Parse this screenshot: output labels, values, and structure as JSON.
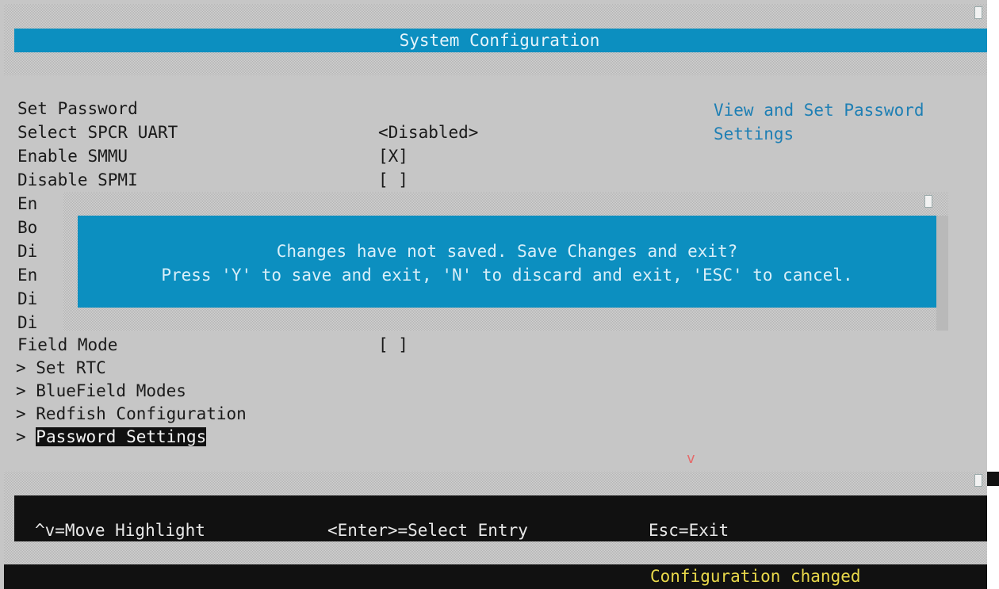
{
  "header": {
    "title": "System Configuration"
  },
  "menu": {
    "rows": [
      {
        "label": "Set Password",
        "value": ""
      },
      {
        "label": "Select SPCR UART",
        "value": "<Disabled>"
      },
      {
        "label": "Enable SMMU",
        "value": "[X]"
      },
      {
        "label": "Disable SPMI",
        "value": "[ ]"
      },
      {
        "label": "En",
        "value": ""
      },
      {
        "label": "Bo",
        "value": ""
      },
      {
        "label": "Di",
        "value": ""
      },
      {
        "label": "En",
        "value": ""
      },
      {
        "label": "Di",
        "value": ""
      },
      {
        "label": "Di",
        "value": ""
      },
      {
        "label": "Field Mode",
        "value": "[ ]"
      }
    ],
    "submenus": [
      "> Set RTC",
      "> BlueField Modes",
      "> Redfish Configuration"
    ],
    "selected_prefix": "> ",
    "selected_label": "Password Settings",
    "more_indicator": "v"
  },
  "help": {
    "line1": "View and Set Password",
    "line2": "Settings"
  },
  "dialog": {
    "line1": "Changes have not saved. Save Changes and exit?",
    "line2": "Press 'Y' to save and exit, 'N' to discard and exit, 'ESC' to cancel."
  },
  "footer": {
    "move": "^v=Move Highlight",
    "select": "<Enter>=Select Entry",
    "exit": "Esc=Exit"
  },
  "status": {
    "text": "Configuration changed"
  },
  "colors": {
    "accent_blue": "#0c8fc0",
    "help_text": "#1e7fb4",
    "status_yellow": "#e8d84a",
    "more_arrow": "#e56a6a"
  }
}
